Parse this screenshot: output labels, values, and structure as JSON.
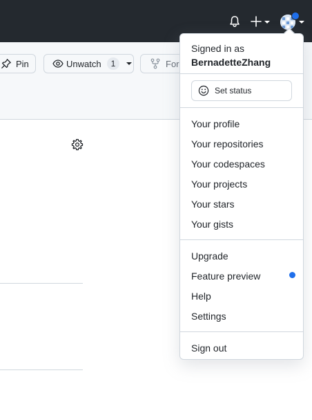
{
  "header": {
    "notifications_icon": "bell-icon",
    "create_icon": "plus-icon",
    "avatar_badge_color": "#1f6feb"
  },
  "repo_actions": {
    "pin_label": "Pin",
    "unwatch_label": "Unwatch",
    "watch_count": "1",
    "fork_label": "Fork"
  },
  "user_menu": {
    "signed_in_as": "Signed in as",
    "username": "BernadetteZhang",
    "set_status_label": "Set status",
    "items": [
      "Your profile",
      "Your repositories",
      "Your codespaces",
      "Your projects",
      "Your stars",
      "Your gists"
    ],
    "upgrade_label": "Upgrade",
    "feature_preview_label": "Feature preview",
    "help_label": "Help",
    "settings_label": "Settings",
    "sign_out_label": "Sign out",
    "feature_preview_dot_color": "#1f6feb"
  }
}
